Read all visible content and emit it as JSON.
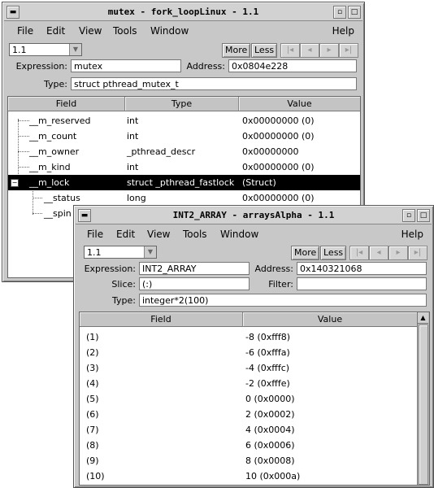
{
  "window1": {
    "title": "mutex - fork_loopLinux - 1.1",
    "menu": [
      "File",
      "Edit",
      "View",
      "Tools",
      "Window",
      "Help"
    ],
    "thread_value": "1.1",
    "more_label": "More",
    "less_label": "Less",
    "expression_label": "Expression:",
    "expression_value": "mutex",
    "address_label": "Address:",
    "address_value": "0x0804e228",
    "type_label": "Type:",
    "type_value": "struct pthread_mutex_t",
    "columns": [
      "Field",
      "Type",
      "Value"
    ],
    "rows": [
      {
        "field": "__m_reserved",
        "type": "int",
        "value": "0x00000000 (0)"
      },
      {
        "field": "__m_count",
        "type": "int",
        "value": "0x00000000 (0)"
      },
      {
        "field": "__m_owner",
        "type": "_pthread_descr",
        "value": "0x00000000"
      },
      {
        "field": "__m_kind",
        "type": "int",
        "value": "0x00000000 (0)"
      },
      {
        "field": "__m_lock",
        "type": "struct _pthread_fastlock",
        "value": "(Struct)"
      },
      {
        "field": "__status",
        "type": "long",
        "value": "0x00000000 (0)"
      },
      {
        "field": "__spin",
        "type": "",
        "value": ""
      }
    ]
  },
  "window2": {
    "title": "INT2_ARRAY - arraysAlpha - 1.1",
    "menu": [
      "File",
      "Edit",
      "View",
      "Tools",
      "Window",
      "Help"
    ],
    "thread_value": "1.1",
    "more_label": "More",
    "less_label": "Less",
    "expression_label": "Expression:",
    "expression_value": "INT2_ARRAY",
    "address_label": "Address:",
    "address_value": "0x140321068",
    "slice_label": "Slice:",
    "slice_value": "(:)",
    "filter_label": "Filter:",
    "filter_value": "",
    "type_label": "Type:",
    "type_value": "integer*2(100)",
    "columns": [
      "Field",
      "Value"
    ],
    "rows": [
      {
        "field": "(1)",
        "value": "-8 (0xfff8)"
      },
      {
        "field": "(2)",
        "value": "-6 (0xfffa)"
      },
      {
        "field": "(3)",
        "value": "-4 (0xfffc)"
      },
      {
        "field": "(4)",
        "value": "-2 (0xfffe)"
      },
      {
        "field": "(5)",
        "value": "0 (0x0000)"
      },
      {
        "field": "(6)",
        "value": "2 (0x0002)"
      },
      {
        "field": "(7)",
        "value": "4 (0x0004)"
      },
      {
        "field": "(8)",
        "value": "6 (0x0006)"
      },
      {
        "field": "(9)",
        "value": "8 (0x0008)"
      },
      {
        "field": "(10)",
        "value": "10 (0x000a)"
      }
    ]
  }
}
